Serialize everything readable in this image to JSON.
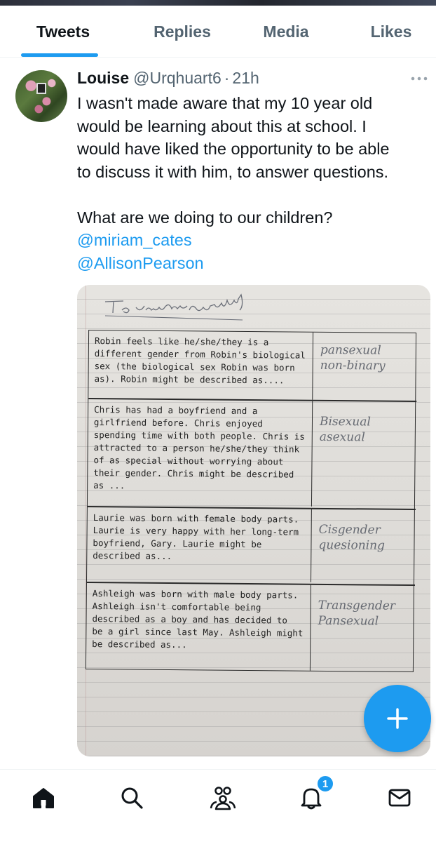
{
  "tabs": [
    {
      "label": "Tweets",
      "active": true
    },
    {
      "label": "Replies",
      "active": false
    },
    {
      "label": "Media",
      "active": false
    },
    {
      "label": "Likes",
      "active": false
    }
  ],
  "tweet": {
    "author_name": "Louise",
    "handle": "@Urqhuart6",
    "separator": "·",
    "time": "21h",
    "more_icon": "more-horizontal-icon",
    "lines": [
      "I wasn't made aware that my 10 year old",
      "would be learning about this at school. I",
      "would have liked the opportunity to be able",
      "to discuss it with him, to answer questions."
    ],
    "question": "What are we doing to our children?",
    "mentions": [
      "@miriam_cates",
      "@AllisonPearson"
    ]
  },
  "worksheet": {
    "rows": [
      {
        "prompt": [
          "Robin feels like he/she/they is a",
          "different gender from Robin's biological",
          "sex (the biological sex Robin was born",
          "as). Robin might be described as...."
        ],
        "answer": [
          "pansexual",
          "non-binary"
        ]
      },
      {
        "prompt": [
          "Chris has had a boyfriend and a",
          "girlfriend before. Chris enjoyed",
          "spending time with both people. Chris is",
          "attracted to a person he/she/they think",
          "of as special without worrying about",
          "their gender. Chris might be described",
          "as ..."
        ],
        "answer": [
          "Bisexual",
          "asexual"
        ]
      },
      {
        "prompt": [
          "Laurie was born with female body parts.",
          "Laurie is very happy with her long-term",
          "boyfriend, Gary. Laurie might be",
          "described as..."
        ],
        "answer": [
          "Cisgender",
          "quesioning"
        ]
      },
      {
        "prompt": [
          "Ashleigh was born with male body parts.",
          "Ashleigh isn't comfortable being",
          "described as a boy and has decided to",
          "be a girl since last May. Ashleigh might",
          "be described as..."
        ],
        "answer": [
          "Transgender",
          "Pansexual"
        ]
      }
    ]
  },
  "fab": {
    "icon": "plus-icon"
  },
  "bottom_nav": {
    "items": [
      {
        "icon": "home-icon"
      },
      {
        "icon": "search-icon"
      },
      {
        "icon": "communities-icon"
      },
      {
        "icon": "notifications-icon"
      },
      {
        "icon": "messages-icon"
      }
    ],
    "notification_badge": "1"
  },
  "colors": {
    "accent": "#1d9bf0",
    "text": "#0f1419",
    "secondary": "#536471"
  }
}
